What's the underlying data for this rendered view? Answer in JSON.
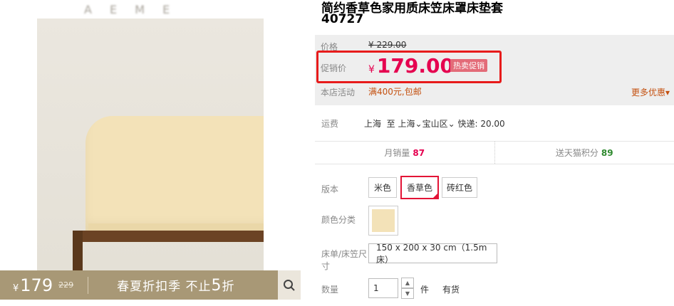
{
  "gallery": {
    "brand_watermark": "A E   M E",
    "promo_price_symbol": "¥",
    "promo_price": "179",
    "promo_old_price": "229",
    "promo_text": "春夏折扣季 不止",
    "promo_number": "5",
    "promo_suffix": "折",
    "search_icon": "search-icon"
  },
  "product": {
    "title_blurred_prefix": "",
    "title_line1": "简约香草色家用",
    "title_blurred_mid": "",
    "title_line1_rest": "质床笠床罩床垫套",
    "title_line2": "40",
    "title_line2_blurred": "",
    "title_line2_rest": "727"
  },
  "price": {
    "original_label": "价格",
    "original_value": "¥ 229.00",
    "promo_label": "促销价",
    "promo_symbol": "¥",
    "promo_value": "179.00",
    "promo_badge": "热卖促销",
    "store_event_label": "本店活动",
    "store_event_value": "满400元,包邮",
    "more_deals": "更多优惠",
    "highlight_color": "#e71b1b",
    "price_color": "#e5004f"
  },
  "shipping": {
    "label": "运费",
    "from": "上海",
    "to_text": "至",
    "to_city": "上海",
    "to_district": "宝山区",
    "express": "快递: 20.00"
  },
  "stats": {
    "monthly_sales_label": "月销量",
    "monthly_sales_value": "87",
    "points_label": "送天猫积分",
    "points_value": "89"
  },
  "options": {
    "version_label": "版本",
    "versions": [
      "米色",
      "香草色",
      "砖红色"
    ],
    "selected_version": "香草色",
    "color_label": "颜色分类",
    "size_label": "床单/床笠尺寸",
    "size_value": "150 x 200 x 30 cm（1.5m床）",
    "qty_label": "数量",
    "qty_value": "1",
    "qty_unit": "件",
    "stock_status": "有货"
  }
}
